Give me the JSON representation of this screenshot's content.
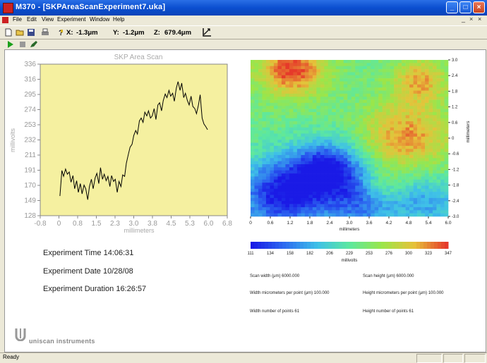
{
  "window": {
    "title": "M370 - [SKPAreaScanExperiment7.uka]"
  },
  "menu": {
    "items": [
      "File",
      "Edit",
      "View",
      "Experiment",
      "Window",
      "Help"
    ],
    "mdi_controls": [
      "_",
      "×",
      "×"
    ]
  },
  "toolbar": {
    "x_label": "X:",
    "x_value": "-1.3μm",
    "y_label": "Y:",
    "y_value": "-1.2μm",
    "z_label": "Z:",
    "z_value": "679.4μm",
    "icons": [
      "new-file-icon",
      "open-folder-icon",
      "save-icon",
      "print-icon",
      "help-icon",
      "chart-axis-icon"
    ]
  },
  "toolbar2": {
    "icons": [
      "play-icon",
      "stop-icon",
      "pen-icon"
    ]
  },
  "line_chart": {
    "title": "SKP Area Scan",
    "xlabel": "millimeters",
    "ylabel": "millivolts"
  },
  "heatmap": {
    "xlabel": "millimeters",
    "ylabel": "millimeters",
    "colorbar_label": "millivolts"
  },
  "chart_data": [
    {
      "type": "line",
      "title": "SKP Area Scan",
      "xlabel": "millimeters",
      "ylabel": "millivolts",
      "xlim": [
        -0.8,
        6.8
      ],
      "ylim": [
        128,
        336
      ],
      "x_ticks": [
        "-0.8",
        "0",
        "0.8",
        "1.5",
        "2.3",
        "3.0",
        "3.8",
        "4.5",
        "5.3",
        "6.0",
        "6.8"
      ],
      "y_ticks": [
        "128",
        "149",
        "170",
        "191",
        "211",
        "232",
        "253",
        "274",
        "295",
        "316",
        "336"
      ],
      "background": "#f5f0a0",
      "line_color": "#000000",
      "x": [
        0.0,
        0.08,
        0.15,
        0.23,
        0.3,
        0.38,
        0.45,
        0.53,
        0.6,
        0.68,
        0.75,
        0.83,
        0.9,
        0.98,
        1.05,
        1.13,
        1.2,
        1.28,
        1.35,
        1.43,
        1.5,
        1.58,
        1.65,
        1.73,
        1.8,
        1.88,
        1.95,
        2.03,
        2.1,
        2.18,
        2.25,
        2.33,
        2.4,
        2.48,
        2.55,
        2.63,
        2.7,
        2.78,
        2.85,
        2.93,
        3.0,
        3.08,
        3.15,
        3.23,
        3.3,
        3.38,
        3.45,
        3.53,
        3.6,
        3.68,
        3.75,
        3.83,
        3.9,
        3.98,
        4.05,
        4.13,
        4.2,
        4.28,
        4.35,
        4.43,
        4.5,
        4.58,
        4.65,
        4.73,
        4.8,
        4.88,
        4.95,
        5.03,
        5.1,
        5.18,
        5.25,
        5.33,
        5.4,
        5.48,
        5.55,
        5.63,
        5.7,
        5.78,
        5.85,
        5.93,
        6.0
      ],
      "y": [
        155,
        190,
        182,
        192,
        185,
        188,
        174,
        183,
        165,
        176,
        160,
        172,
        158,
        170,
        165,
        150,
        168,
        178,
        165,
        180,
        186,
        172,
        194,
        178,
        185,
        176,
        182,
        168,
        183,
        175,
        178,
        160,
        175,
        168,
        184,
        182,
        200,
        212,
        222,
        226,
        238,
        245,
        240,
        258,
        262,
        256,
        270,
        265,
        272,
        262,
        265,
        275,
        260,
        280,
        283,
        272,
        286,
        295,
        290,
        300,
        292,
        296,
        285,
        303,
        312,
        300,
        310,
        290,
        296,
        286,
        280,
        292,
        278,
        275,
        268,
        280,
        294,
        262,
        254,
        250,
        246
      ]
    },
    {
      "type": "heatmap",
      "xlabel": "millimeters",
      "ylabel": "millimeters",
      "colorbar_label": "millivolts",
      "x_ticks": [
        "0",
        "0.6",
        "1.2",
        "1.8",
        "2.4",
        "3.0",
        "3.6",
        "4.2",
        "4.8",
        "5.4",
        "6.0"
      ],
      "y_ticks": [
        "3.0",
        "2.4",
        "1.8",
        "1.2",
        "0.6",
        "0",
        "-0.6",
        "-1.2",
        "-1.8",
        "-2.4",
        "-3.0"
      ],
      "colorbar_ticks": [
        "111",
        "134",
        "158",
        "182",
        "206",
        "229",
        "253",
        "276",
        "300",
        "323",
        "347"
      ],
      "value_range": [
        111,
        347
      ],
      "grid_size": [
        51,
        51
      ],
      "colormap": [
        "#1a1ae6",
        "#2d6bf0",
        "#3ec0e8",
        "#5ce8a0",
        "#9ae64a",
        "#e6c23a",
        "#e63a2a"
      ]
    }
  ],
  "experiment": {
    "time": "Experiment Time 14:06:31",
    "date": "Experiment Date 10/28/08",
    "duration": "Experiment Duration 16:26:57"
  },
  "scan_params": {
    "scan_width": "Scan width (μm) 6000.000",
    "scan_height": "Scan height (μm) 6000.000",
    "width_per_point": "Width micrometers per point (μm) 100.000",
    "height_per_point": "Height micrometers per point (μm) 100.000",
    "width_points": "Width number of points 61",
    "height_points": "Height number of points 61"
  },
  "logo": {
    "text": "uniscan instruments"
  },
  "status": {
    "text": "Ready"
  }
}
